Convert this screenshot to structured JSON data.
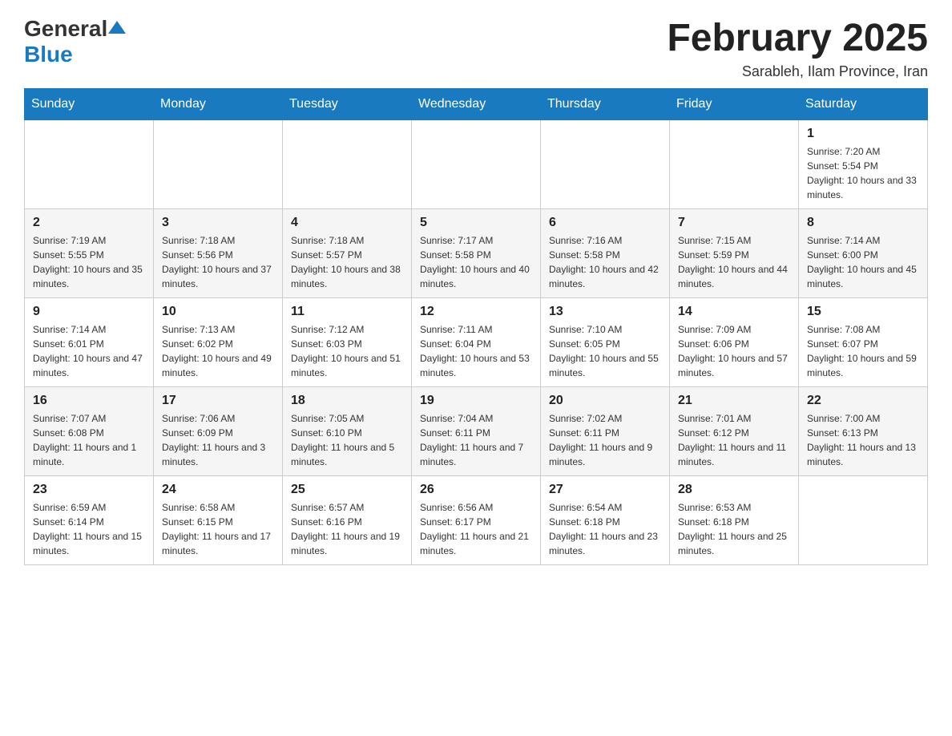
{
  "header": {
    "logo_general": "General",
    "logo_blue": "Blue",
    "month_title": "February 2025",
    "location": "Sarableh, Ilam Province, Iran"
  },
  "days_of_week": [
    "Sunday",
    "Monday",
    "Tuesday",
    "Wednesday",
    "Thursday",
    "Friday",
    "Saturday"
  ],
  "weeks": [
    {
      "row_class": "week-row-light",
      "days": [
        {
          "date": "",
          "sunrise": "",
          "sunset": "",
          "daylight": ""
        },
        {
          "date": "",
          "sunrise": "",
          "sunset": "",
          "daylight": ""
        },
        {
          "date": "",
          "sunrise": "",
          "sunset": "",
          "daylight": ""
        },
        {
          "date": "",
          "sunrise": "",
          "sunset": "",
          "daylight": ""
        },
        {
          "date": "",
          "sunrise": "",
          "sunset": "",
          "daylight": ""
        },
        {
          "date": "",
          "sunrise": "",
          "sunset": "",
          "daylight": ""
        },
        {
          "date": "1",
          "sunrise": "Sunrise: 7:20 AM",
          "sunset": "Sunset: 5:54 PM",
          "daylight": "Daylight: 10 hours and 33 minutes."
        }
      ]
    },
    {
      "row_class": "week-row-dark",
      "days": [
        {
          "date": "2",
          "sunrise": "Sunrise: 7:19 AM",
          "sunset": "Sunset: 5:55 PM",
          "daylight": "Daylight: 10 hours and 35 minutes."
        },
        {
          "date": "3",
          "sunrise": "Sunrise: 7:18 AM",
          "sunset": "Sunset: 5:56 PM",
          "daylight": "Daylight: 10 hours and 37 minutes."
        },
        {
          "date": "4",
          "sunrise": "Sunrise: 7:18 AM",
          "sunset": "Sunset: 5:57 PM",
          "daylight": "Daylight: 10 hours and 38 minutes."
        },
        {
          "date": "5",
          "sunrise": "Sunrise: 7:17 AM",
          "sunset": "Sunset: 5:58 PM",
          "daylight": "Daylight: 10 hours and 40 minutes."
        },
        {
          "date": "6",
          "sunrise": "Sunrise: 7:16 AM",
          "sunset": "Sunset: 5:58 PM",
          "daylight": "Daylight: 10 hours and 42 minutes."
        },
        {
          "date": "7",
          "sunrise": "Sunrise: 7:15 AM",
          "sunset": "Sunset: 5:59 PM",
          "daylight": "Daylight: 10 hours and 44 minutes."
        },
        {
          "date": "8",
          "sunrise": "Sunrise: 7:14 AM",
          "sunset": "Sunset: 6:00 PM",
          "daylight": "Daylight: 10 hours and 45 minutes."
        }
      ]
    },
    {
      "row_class": "week-row-light",
      "days": [
        {
          "date": "9",
          "sunrise": "Sunrise: 7:14 AM",
          "sunset": "Sunset: 6:01 PM",
          "daylight": "Daylight: 10 hours and 47 minutes."
        },
        {
          "date": "10",
          "sunrise": "Sunrise: 7:13 AM",
          "sunset": "Sunset: 6:02 PM",
          "daylight": "Daylight: 10 hours and 49 minutes."
        },
        {
          "date": "11",
          "sunrise": "Sunrise: 7:12 AM",
          "sunset": "Sunset: 6:03 PM",
          "daylight": "Daylight: 10 hours and 51 minutes."
        },
        {
          "date": "12",
          "sunrise": "Sunrise: 7:11 AM",
          "sunset": "Sunset: 6:04 PM",
          "daylight": "Daylight: 10 hours and 53 minutes."
        },
        {
          "date": "13",
          "sunrise": "Sunrise: 7:10 AM",
          "sunset": "Sunset: 6:05 PM",
          "daylight": "Daylight: 10 hours and 55 minutes."
        },
        {
          "date": "14",
          "sunrise": "Sunrise: 7:09 AM",
          "sunset": "Sunset: 6:06 PM",
          "daylight": "Daylight: 10 hours and 57 minutes."
        },
        {
          "date": "15",
          "sunrise": "Sunrise: 7:08 AM",
          "sunset": "Sunset: 6:07 PM",
          "daylight": "Daylight: 10 hours and 59 minutes."
        }
      ]
    },
    {
      "row_class": "week-row-dark",
      "days": [
        {
          "date": "16",
          "sunrise": "Sunrise: 7:07 AM",
          "sunset": "Sunset: 6:08 PM",
          "daylight": "Daylight: 11 hours and 1 minute."
        },
        {
          "date": "17",
          "sunrise": "Sunrise: 7:06 AM",
          "sunset": "Sunset: 6:09 PM",
          "daylight": "Daylight: 11 hours and 3 minutes."
        },
        {
          "date": "18",
          "sunrise": "Sunrise: 7:05 AM",
          "sunset": "Sunset: 6:10 PM",
          "daylight": "Daylight: 11 hours and 5 minutes."
        },
        {
          "date": "19",
          "sunrise": "Sunrise: 7:04 AM",
          "sunset": "Sunset: 6:11 PM",
          "daylight": "Daylight: 11 hours and 7 minutes."
        },
        {
          "date": "20",
          "sunrise": "Sunrise: 7:02 AM",
          "sunset": "Sunset: 6:11 PM",
          "daylight": "Daylight: 11 hours and 9 minutes."
        },
        {
          "date": "21",
          "sunrise": "Sunrise: 7:01 AM",
          "sunset": "Sunset: 6:12 PM",
          "daylight": "Daylight: 11 hours and 11 minutes."
        },
        {
          "date": "22",
          "sunrise": "Sunrise: 7:00 AM",
          "sunset": "Sunset: 6:13 PM",
          "daylight": "Daylight: 11 hours and 13 minutes."
        }
      ]
    },
    {
      "row_class": "week-row-light",
      "days": [
        {
          "date": "23",
          "sunrise": "Sunrise: 6:59 AM",
          "sunset": "Sunset: 6:14 PM",
          "daylight": "Daylight: 11 hours and 15 minutes."
        },
        {
          "date": "24",
          "sunrise": "Sunrise: 6:58 AM",
          "sunset": "Sunset: 6:15 PM",
          "daylight": "Daylight: 11 hours and 17 minutes."
        },
        {
          "date": "25",
          "sunrise": "Sunrise: 6:57 AM",
          "sunset": "Sunset: 6:16 PM",
          "daylight": "Daylight: 11 hours and 19 minutes."
        },
        {
          "date": "26",
          "sunrise": "Sunrise: 6:56 AM",
          "sunset": "Sunset: 6:17 PM",
          "daylight": "Daylight: 11 hours and 21 minutes."
        },
        {
          "date": "27",
          "sunrise": "Sunrise: 6:54 AM",
          "sunset": "Sunset: 6:18 PM",
          "daylight": "Daylight: 11 hours and 23 minutes."
        },
        {
          "date": "28",
          "sunrise": "Sunrise: 6:53 AM",
          "sunset": "Sunset: 6:18 PM",
          "daylight": "Daylight: 11 hours and 25 minutes."
        },
        {
          "date": "",
          "sunrise": "",
          "sunset": "",
          "daylight": ""
        }
      ]
    }
  ]
}
